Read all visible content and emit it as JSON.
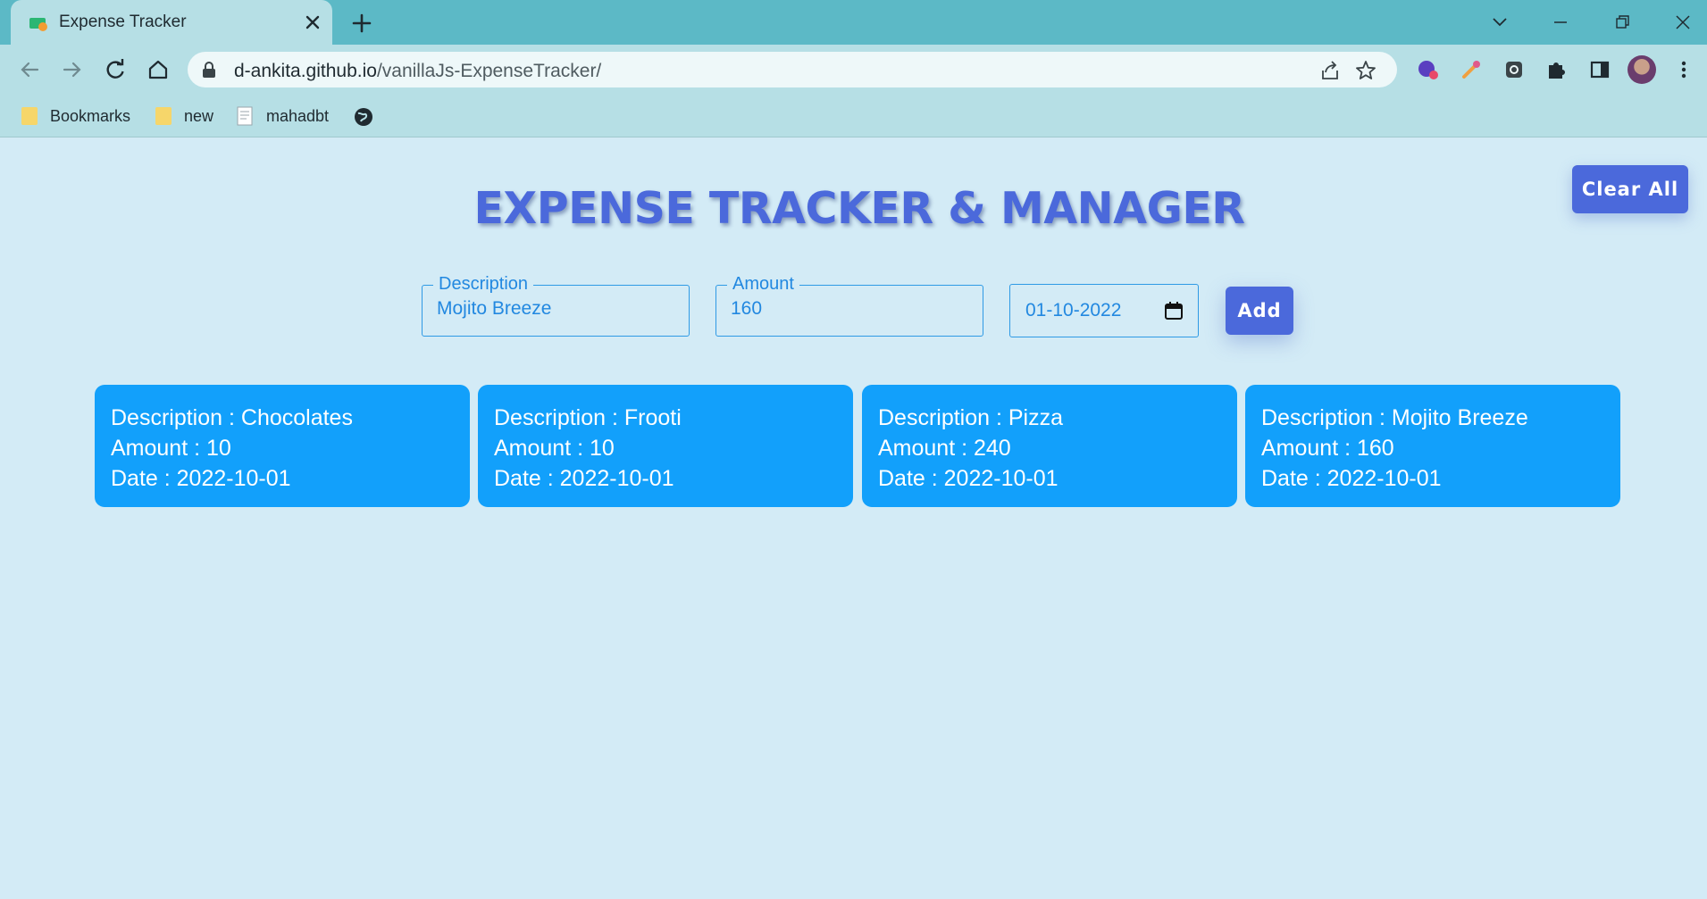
{
  "browser": {
    "tab": {
      "title": "Expense Tracker"
    },
    "address": {
      "domain": "d-ankita.github.io",
      "path": "/vanillaJs-ExpenseTracker/"
    },
    "bookmarks": [
      {
        "label": "Bookmarks",
        "icon": "folder-icon"
      },
      {
        "label": "new",
        "icon": "folder-icon"
      },
      {
        "label": "mahadbt",
        "icon": "document-icon"
      },
      {
        "label": "",
        "icon": "globe-icon"
      }
    ]
  },
  "header": {
    "title": "EXPENSE TRACKER & MANAGER",
    "clear_all_label": "Clear All"
  },
  "form": {
    "description": {
      "label": "Description",
      "value": "Mojito Breeze"
    },
    "amount": {
      "label": "Amount",
      "value": "160"
    },
    "date": {
      "value": "01-10-2022"
    },
    "add_label": "Add"
  },
  "expenses": [
    {
      "description": "Description : Chocolates",
      "amount": "Amount : 10",
      "date": "Date : 2022-10-01"
    },
    {
      "description": "Description : Frooti",
      "amount": "Amount : 10",
      "date": "Date : 2022-10-01"
    },
    {
      "description": "Description : Pizza",
      "amount": "Amount : 240",
      "date": "Date : 2022-10-01"
    },
    {
      "description": "Description : Mojito Breeze",
      "amount": "Amount : 160",
      "date": "Date : 2022-10-01"
    }
  ],
  "colors": {
    "page_background": "#d3ebf6",
    "accent": "#4b69db",
    "card": "#12a0fb",
    "input_text": "#2288e0"
  }
}
